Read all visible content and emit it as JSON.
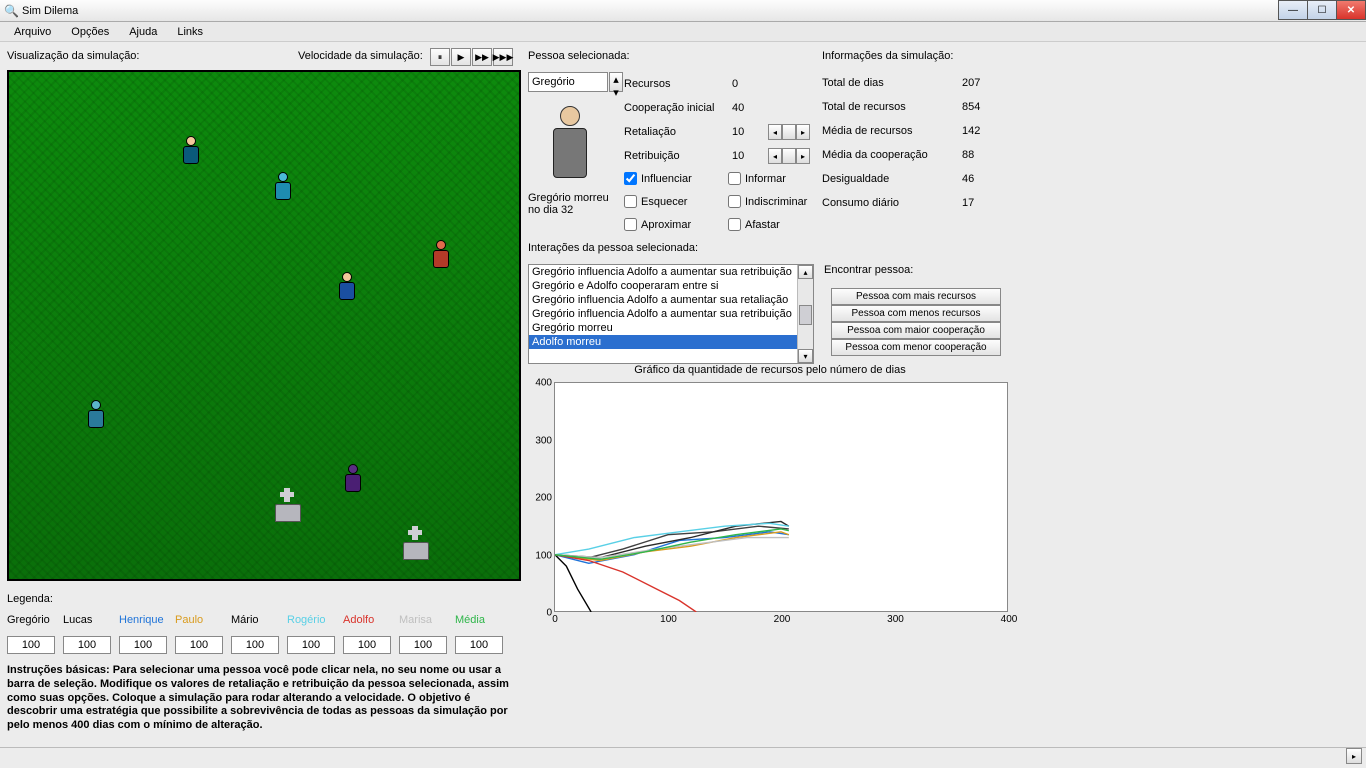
{
  "window": {
    "title": "Sim Dilema"
  },
  "menu": {
    "arquivo": "Arquivo",
    "opcoes": "Opções",
    "ajuda": "Ajuda",
    "links": "Links"
  },
  "labels": {
    "visualizacao": "Visualização da simulação:",
    "velocidade": "Velocidade da simulação:",
    "pessoa_sel": "Pessoa selecionada:",
    "info_sim": "Informações da simulação:",
    "interacoes": "Interações da pessoa selecionada:",
    "encontrar": "Encontrar pessoa:",
    "legenda": "Legenda:",
    "grafico": "Gráfico da quantidade de recursos pelo número de dias"
  },
  "speed_buttons": [
    "⏸",
    "▶",
    "▶▶",
    "▶▶▶"
  ],
  "selected_person": {
    "name": "Gregório",
    "status": "Gregório morreu no dia 32",
    "params": {
      "recursos": {
        "label": "Recursos",
        "value": "0"
      },
      "coop_inicial": {
        "label": "Cooperação inicial",
        "value": "40"
      },
      "retaliacao": {
        "label": "Retaliação",
        "value": "10"
      },
      "retribuicao": {
        "label": "Retribuição",
        "value": "10"
      }
    },
    "flags": {
      "influenciar": {
        "label": "Influenciar",
        "checked": true
      },
      "esquecer": {
        "label": "Esquecer",
        "checked": false
      },
      "aproximar": {
        "label": "Aproximar",
        "checked": false
      },
      "informar": {
        "label": "Informar",
        "checked": false
      },
      "indiscriminar": {
        "label": "Indiscriminar",
        "checked": false
      },
      "afastar": {
        "label": "Afastar",
        "checked": false
      }
    }
  },
  "sim_info": {
    "total_dias": {
      "label": "Total de dias",
      "value": "207"
    },
    "total_recursos": {
      "label": "Total de recursos",
      "value": "854"
    },
    "media_recursos": {
      "label": "Média de recursos",
      "value": "142"
    },
    "media_coop": {
      "label": "Média da cooperação",
      "value": "88"
    },
    "desigualdade": {
      "label": "Desigualdade",
      "value": "46"
    },
    "consumo": {
      "label": "Consumo diário",
      "value": "17"
    }
  },
  "interactions": [
    "Gregório influencia Adolfo a aumentar sua retribuição",
    "Gregório e Adolfo cooperaram entre si",
    "Gregório influencia Adolfo a aumentar sua retaliação",
    "Gregório influencia Adolfo a aumentar sua retribuição",
    "Gregório morreu",
    "Adolfo morreu"
  ],
  "interactions_selected_index": 5,
  "find_buttons": [
    "Pessoa com mais recursos",
    "Pessoa com menos recursos",
    "Pessoa com maior cooperação",
    "Pessoa com menor cooperação"
  ],
  "legend": [
    {
      "name": "Gregório",
      "color": "#000000",
      "value": "100"
    },
    {
      "name": "Lucas",
      "color": "#000000",
      "value": "100"
    },
    {
      "name": "Henrique",
      "color": "#1e73d8",
      "value": "100"
    },
    {
      "name": "Paulo",
      "color": "#d99b1e",
      "value": "100"
    },
    {
      "name": "Mário",
      "color": "#000000",
      "value": "100"
    },
    {
      "name": "Rogério",
      "color": "#59d0e6",
      "value": "100"
    },
    {
      "name": "Adolfo",
      "color": "#d9332b",
      "value": "100"
    },
    {
      "name": "Marisa",
      "color": "#bfbfbf",
      "value": "100"
    },
    {
      "name": "Média",
      "color": "#2fb64a",
      "value": "100"
    }
  ],
  "instructions": "Instruções básicas: Para selecionar uma pessoa você pode clicar nela, no seu nome ou usar a barra de seleção. Modifique os valores de retaliação e retribuição da pessoa selecionada, assim como suas opções. Coloque a simulação para rodar alterando a velocidade. O objetivo é descobrir uma estratégia que possibilite a sobrevivência de todas as pessoas da simulação por pelo menos 400 dias com o mínimo de alteração.",
  "chart_data": {
    "type": "line",
    "title": "Gráfico da quantidade de recursos pelo número de dias",
    "xlabel": "",
    "ylabel": "",
    "xlim": [
      0,
      400
    ],
    "ylim": [
      0,
      400
    ],
    "xticks": [
      0,
      100,
      200,
      300,
      400
    ],
    "yticks": [
      0,
      100,
      200,
      300,
      400
    ],
    "series": [
      {
        "name": "Gregório",
        "color": "#000000",
        "x": [
          0,
          10,
          20,
          32
        ],
        "y": [
          100,
          80,
          40,
          0
        ]
      },
      {
        "name": "Lucas",
        "color": "#404040",
        "x": [
          0,
          30,
          60,
          100,
          140,
          180,
          207
        ],
        "y": [
          100,
          95,
          110,
          135,
          140,
          150,
          145
        ]
      },
      {
        "name": "Henrique",
        "color": "#1e73d8",
        "x": [
          0,
          30,
          70,
          110,
          150,
          190,
          207
        ],
        "y": [
          100,
          85,
          100,
          125,
          130,
          140,
          135
        ]
      },
      {
        "name": "Paulo",
        "color": "#d99b1e",
        "x": [
          0,
          40,
          80,
          120,
          160,
          200,
          207
        ],
        "y": [
          100,
          90,
          105,
          115,
          130,
          140,
          135
        ]
      },
      {
        "name": "Mário",
        "color": "#2a2a2a",
        "x": [
          0,
          40,
          80,
          120,
          160,
          200,
          207
        ],
        "y": [
          100,
          95,
          115,
          130,
          150,
          158,
          150
        ]
      },
      {
        "name": "Rogério",
        "color": "#59d0e6",
        "x": [
          0,
          30,
          70,
          110,
          150,
          190,
          207
        ],
        "y": [
          100,
          110,
          130,
          140,
          150,
          155,
          150
        ]
      },
      {
        "name": "Adolfo",
        "color": "#d9332b",
        "x": [
          0,
          30,
          60,
          90,
          110,
          125
        ],
        "y": [
          100,
          90,
          70,
          40,
          20,
          0
        ]
      },
      {
        "name": "Marisa",
        "color": "#bfbfbf",
        "x": [
          0,
          40,
          90,
          130,
          170,
          207
        ],
        "y": [
          100,
          95,
          110,
          120,
          130,
          130
        ]
      },
      {
        "name": "Média",
        "color": "#2fb64a",
        "x": [
          0,
          40,
          80,
          120,
          160,
          200,
          207
        ],
        "y": [
          100,
          92,
          105,
          122,
          135,
          145,
          142
        ]
      }
    ]
  }
}
